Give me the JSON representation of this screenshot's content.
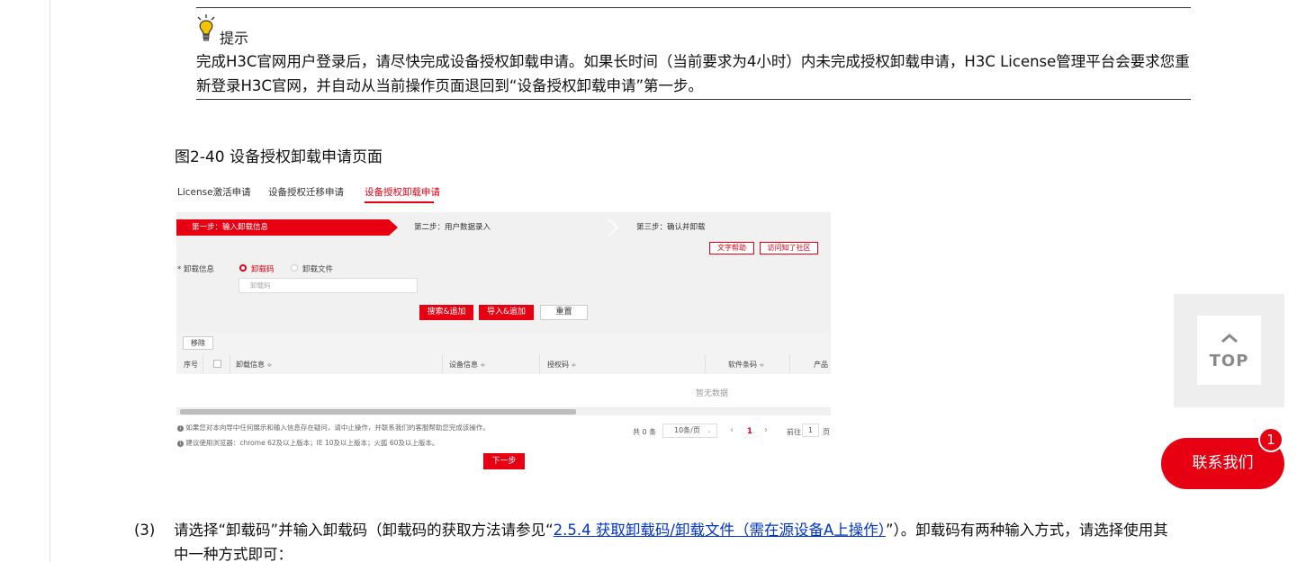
{
  "tip": {
    "icon": "lightbulb-icon",
    "title": "提示",
    "text": "完成H3C官网用户登录后，请尽快完成设备授权卸载申请。如果长时间（当前要求为4小时）内未完成授权卸载申请，H3C License管理平台会要求您重新登录H3C官网，并自动从当前操作页面退回到“设备授权卸载申请”第一步。"
  },
  "figure": {
    "caption": "图2-40 设备授权卸载申请页面",
    "tabs": [
      "License激活申请",
      "设备授权迁移申请",
      "设备授权卸载申请"
    ],
    "active_tab": "设备授权卸载申请",
    "steps": [
      "第一步：输入卸载信息",
      "第二步：用户数据录入",
      "第三步：确认并卸载"
    ],
    "help_button": "文字帮助",
    "community_button": "访问知了社区",
    "form_label": "* 卸载信息",
    "radio_code": "卸载码",
    "radio_file": "卸载文件",
    "input_placeholder": "卸载码",
    "search_add_button": "搜索&追加",
    "import_add_button": "导入&追加",
    "reset_button": "重置",
    "remove_button": "移除",
    "columns": {
      "index": "序号",
      "uninstall_info": "卸载信息",
      "device_info": "设备信息",
      "auth_code": "授权码",
      "software_barcode": "软件条码",
      "product": "产品"
    },
    "sort_glyph": "≑",
    "empty_text": "暂无数据",
    "note1": "如果您对本向导中任何展示和输入信息存在疑问，请中止操作，并联系我们的客服帮助您完成该操作。",
    "note2": "建议使用浏览器：chrome 62及以上版本；IE 10及以上版本；火狐 60及以上版本。",
    "total": "共 0 条",
    "page_size": "10条/页",
    "prev": "‹",
    "current_page": "1",
    "next": "›",
    "goto_label": "前往",
    "goto_value": "1",
    "page_unit": "页",
    "next_button": "下一步",
    "accent_color": "#e60012"
  },
  "top_button": {
    "label": "TOP",
    "icon": "chevron-up-icon"
  },
  "contact": {
    "label": "联系我们",
    "badge": "1"
  },
  "step3": {
    "number": "(3)",
    "text_before": "请选择“卸载码”并输入卸载码（卸载码的获取方法请参见“",
    "link_text": "2.5.4  获取卸载码/卸载文件（需在源设备A上操作）",
    "text_after": "”）。卸载码有两种输入方式，请选择使用其中一种方式即可："
  }
}
